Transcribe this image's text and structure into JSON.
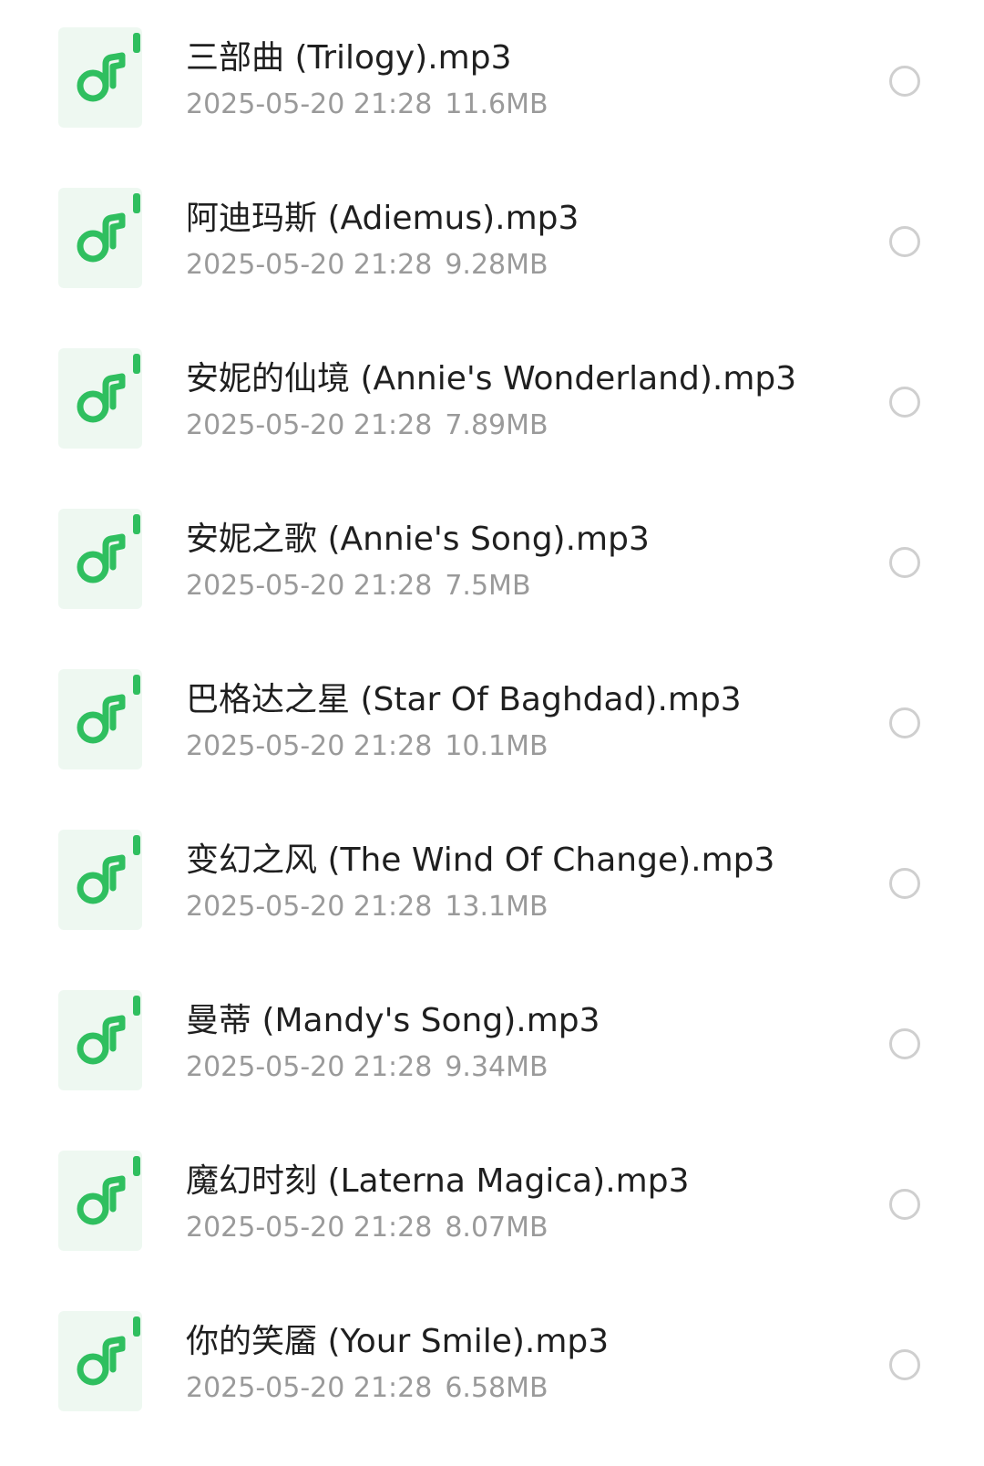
{
  "files": [
    {
      "name": "三部曲 (Trilogy).mp3",
      "date": "2025-05-20 21:28",
      "size": "11.6MB",
      "icon": "music-file-icon"
    },
    {
      "name": "阿迪玛斯 (Adiemus).mp3",
      "date": "2025-05-20 21:28",
      "size": "9.28MB",
      "icon": "music-file-icon"
    },
    {
      "name": "安妮的仙境 (Annie's Wonderland).mp3",
      "date": "2025-05-20 21:28",
      "size": "7.89MB",
      "icon": "music-file-icon"
    },
    {
      "name": "安妮之歌 (Annie's Song).mp3",
      "date": "2025-05-20 21:28",
      "size": "7.5MB",
      "icon": "music-file-icon"
    },
    {
      "name": "巴格达之星 (Star Of Baghdad).mp3",
      "date": "2025-05-20 21:28",
      "size": "10.1MB",
      "icon": "music-file-icon"
    },
    {
      "name": "变幻之风 (The Wind Of Change).mp3",
      "date": "2025-05-20 21:28",
      "size": "13.1MB",
      "icon": "music-file-icon"
    },
    {
      "name": "曼蒂 (Mandy's Song).mp3",
      "date": "2025-05-20 21:28",
      "size": "9.34MB",
      "icon": "music-file-icon"
    },
    {
      "name": "魔幻时刻 (Laterna Magica).mp3",
      "date": "2025-05-20 21:28",
      "size": "8.07MB",
      "icon": "music-file-icon"
    },
    {
      "name": "你的笑靥 (Your Smile).mp3",
      "date": "2025-05-20 21:28",
      "size": "6.58MB",
      "icon": "music-file-icon"
    }
  ],
  "colors": {
    "icon_green": "#2fbf5f",
    "icon_bg": "#eef8f1",
    "radio_border": "#cfcfcf",
    "meta_text": "#9a9a9a",
    "name_text": "#1f1f1f"
  }
}
